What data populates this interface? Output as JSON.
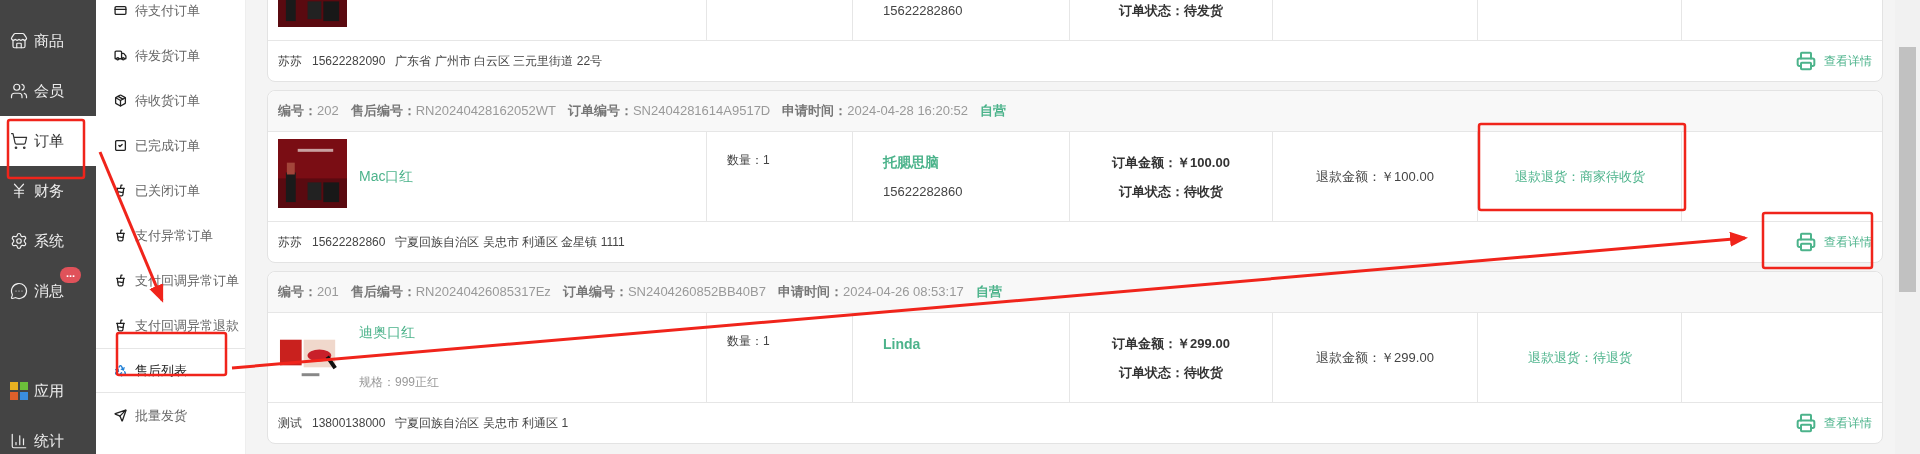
{
  "main_nav": {
    "items": [
      {
        "label": "商品",
        "selected": false
      },
      {
        "label": "会员",
        "selected": false
      },
      {
        "label": "订单",
        "selected": true
      },
      {
        "label": "财务",
        "selected": false
      },
      {
        "label": "系统",
        "selected": false
      },
      {
        "label": "消息",
        "selected": false,
        "badge": "..."
      }
    ],
    "bottom_items": [
      {
        "label": "应用",
        "selected": false
      },
      {
        "label": "统计",
        "selected": false
      }
    ]
  },
  "sub_nav": {
    "items": [
      {
        "label": "待支付订单",
        "selected": false
      },
      {
        "label": "待发货订单",
        "selected": false
      },
      {
        "label": "待收货订单",
        "selected": false
      },
      {
        "label": "已完成订单",
        "selected": false
      },
      {
        "label": "已关闭订单",
        "selected": false
      },
      {
        "label": "支付异常订单",
        "selected": false
      },
      {
        "label": "支付回调异常订单",
        "selected": false
      },
      {
        "label": "支付回调异常退款",
        "selected": false
      },
      {
        "label": "售后列表",
        "selected": true
      },
      {
        "label": "批量发货",
        "selected": false
      }
    ]
  },
  "after_sales": [
    {
      "buyer": {
        "phone": "15622282860"
      },
      "amounts": {
        "order_status": "订单状态：待发货"
      },
      "footer": {
        "name": "苏苏",
        "phone": "15622282090",
        "address": "广东省 广州市 白云区 三元里街道 22号",
        "link": "查看详情"
      }
    },
    {
      "header": {
        "fields": [
          {
            "label": "编号：",
            "value": "202"
          },
          {
            "label": "售后编号：",
            "value": "RN20240428162052WT"
          },
          {
            "label": "订单编号：",
            "value": "SN2404281614A9517D"
          },
          {
            "label": "申请时间：",
            "value": "2024-04-28 16:20:52"
          }
        ],
        "tag": "自营"
      },
      "product": {
        "name": "Mac口红"
      },
      "quantity": "数量：1",
      "buyer": {
        "name": "托腮思脑",
        "phone": "15622282860"
      },
      "amounts": {
        "order_amount": "订单金额：￥100.00",
        "order_status": "订单状态：待收货"
      },
      "refund": "退款金额：￥100.00",
      "status": "退款退货：商家待收货",
      "footer": {
        "name": "苏苏",
        "phone": "15622282860",
        "address": "宁夏回族自治区 吴忠市 利通区 金星镇 1111",
        "link": "查看详情"
      }
    },
    {
      "header": {
        "fields": [
          {
            "label": "编号：",
            "value": "201"
          },
          {
            "label": "售后编号：",
            "value": "RN20240426085317Ez"
          },
          {
            "label": "订单编号：",
            "value": "SN2404260852BB40B7"
          },
          {
            "label": "申请时间：",
            "value": "2024-04-26 08:53:17"
          }
        ],
        "tag": "自营"
      },
      "product": {
        "name": "迪奥口红",
        "spec": "规格：999正红"
      },
      "quantity": "数量：1",
      "buyer": {
        "name": "Linda"
      },
      "amounts": {
        "order_amount": "订单金额：￥299.00",
        "order_status": "订单状态：待收货"
      },
      "refund": "退款金额：￥299.00",
      "status": "退款退货：待退货",
      "footer": {
        "name": "测试",
        "phone": "13800138000",
        "address": "宁夏回族自治区 吴忠市 利通区 1",
        "link": "查看详情"
      }
    }
  ]
}
